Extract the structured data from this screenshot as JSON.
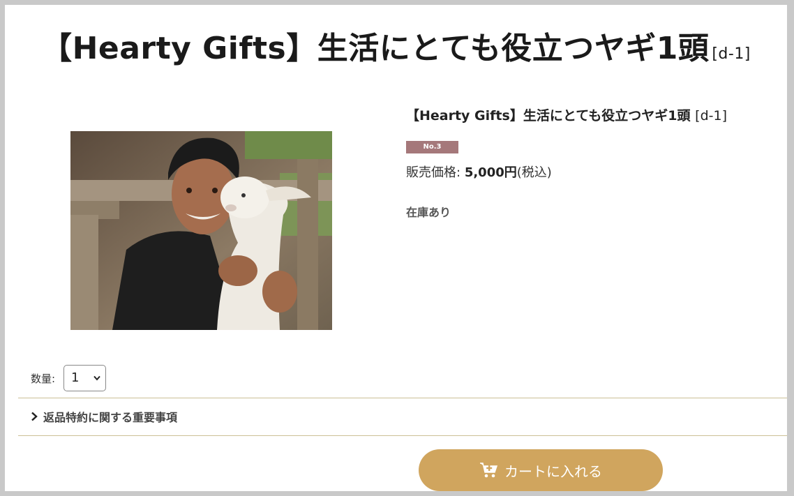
{
  "header": {
    "title": "【Hearty Gifts】生活にとても役立つヤギ1頭",
    "code": "[d-1]"
  },
  "product": {
    "name": "【Hearty Gifts】生活にとても役立つヤギ1頭",
    "code": "[d-1]",
    "badge": "No.3",
    "price_label": "販売価格:",
    "price_value": "5,000円",
    "tax_note": "(税込)",
    "stock": "在庫あり",
    "image_alt": "boy-holding-goat-photo"
  },
  "quantity": {
    "label": "数量:",
    "selected": "1"
  },
  "notice": {
    "label": "返品特約に関する重要事項"
  },
  "cart": {
    "label": "カートに入れる"
  },
  "colors": {
    "badge": "#a5787a",
    "cart_button": "#d0a55e",
    "divider": "#cbbf95"
  }
}
